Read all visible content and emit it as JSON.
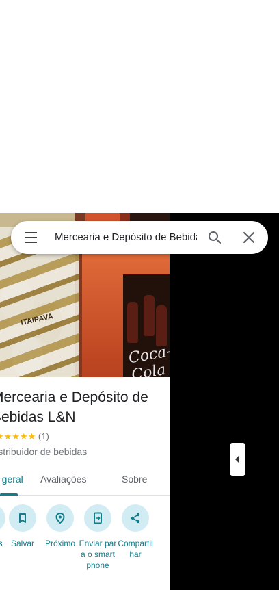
{
  "search": {
    "query": "Mercearia e Depósito de Bebidas L&N"
  },
  "place": {
    "name": "Mercearia e Depósito de Bebidas L&N",
    "stars": "★★★★★",
    "review_count": "(1)",
    "category": "Distribuidor de bebidas",
    "photo_text_1": "Coca-Cola",
    "photo_text_2": "ITAIPAVA"
  },
  "tabs": [
    {
      "label": "Visão geral",
      "active": true
    },
    {
      "label": "Avaliações",
      "active": false
    },
    {
      "label": "Sobre",
      "active": false
    }
  ],
  "actions": [
    {
      "label": "Rotas",
      "icon": "directions-icon"
    },
    {
      "label": "Salvar",
      "icon": "bookmark-icon"
    },
    {
      "label": "Próximo",
      "icon": "nearby-icon"
    },
    {
      "label": "Enviar para o smartphone",
      "icon": "send-to-phone-icon"
    },
    {
      "label": "Compartilhar",
      "icon": "share-icon"
    }
  ],
  "colors": {
    "accent": "#137d89",
    "action_bg": "#d2ecf4",
    "stars": "#fbbc04"
  }
}
